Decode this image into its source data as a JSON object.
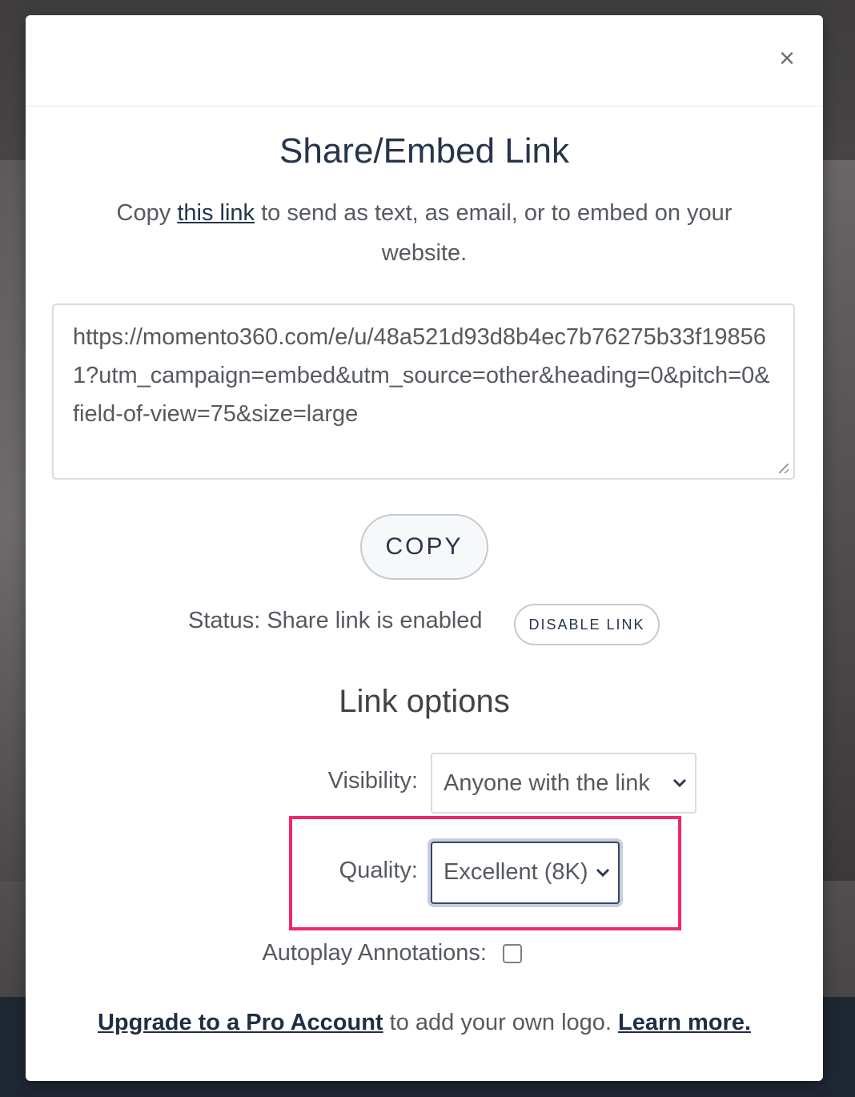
{
  "modal": {
    "close_symbol": "×",
    "title": "Share/Embed Link",
    "subtitle_prefix": "Copy ",
    "subtitle_link": "this link",
    "subtitle_suffix": " to send as text, as email, or to embed on your website.",
    "url": "https://momento360.com/e/u/48a521d93d8b4ec7b76275b33f198561?utm_campaign=embed&utm_source=other&heading=0&pitch=0&field-of-view=75&size=large",
    "copy_label": "COPY",
    "status_text": "Status: Share link is enabled",
    "disable_label": "DISABLE LINK"
  },
  "link_options": {
    "title": "Link options",
    "visibility_label": "Visibility:",
    "visibility_value": "Anyone with the link",
    "quality_label": "Quality:",
    "quality_value": "Excellent (8K)",
    "autoplay_label": "Autoplay Annotations:",
    "autoplay_checked": false
  },
  "footer": {
    "upgrade_link": "Upgrade to a Pro Account",
    "middle_text": " to add your own logo. ",
    "learn_more_link": "Learn more."
  },
  "colors": {
    "highlight": "#f0286a",
    "title_text": "#26354a",
    "focus_ring": "#2d4a6e"
  },
  "icons": {
    "close": "close-icon",
    "chevron": "chevron-down-icon"
  }
}
